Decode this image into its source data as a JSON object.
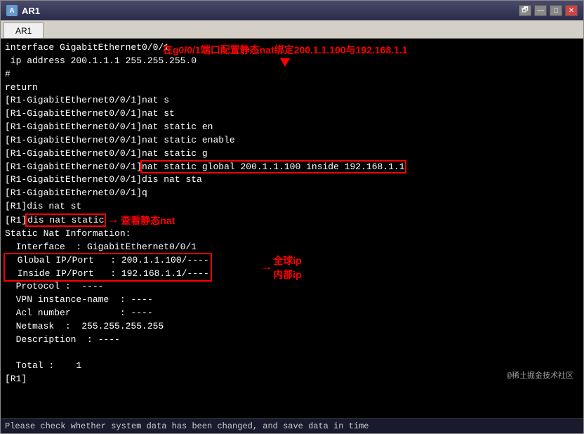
{
  "window": {
    "title": "AR1",
    "tab": "AR1"
  },
  "terminal": {
    "lines": [
      "interface GigabitEthernet0/0/1",
      " ip address 200.1.1.1 255.255.255.0",
      "#",
      "return",
      "[R1-GigabitEthernet0/0/1]nat s",
      "[R1-GigabitEthernet0/0/1]nat st",
      "[R1-GigabitEthernet0/0/1]nat static en",
      "[R1-GigabitEthernet0/0/1]nat static enable",
      "[R1-GigabitEthernet0/0/1]nat static g",
      "[R1-GigabitEthernet0/0/1]nat static global 200.1.1.100 inside 192.168.1.1",
      "[R1-GigabitEthernet0/0/1]dis nat sta",
      "[R1-GigabitEthernet0/0/1]q",
      "[R1]dis nat st",
      "[R1]dis nat static",
      "Static Nat Information:",
      "  Interface  : GigabitEthernet0/0/1",
      "  Global IP/Port   : 200.1.1.100/----",
      "  Inside IP/Port   : 192.168.1.1/----",
      "  Protocol :  ----",
      "  VPN instance-name  : ----",
      "  Acl number         : ----",
      "  Netmask  :  255.255.255.255",
      "  Description  : ----",
      "",
      "  Total :    1",
      "[R1]"
    ],
    "annotation_top": "在g0/0/1端口配置静态nat绑定200.1.1.100与192.168.1.1",
    "annotation_nat_static": "查看静态nat",
    "annotation_global": "全球ip",
    "annotation_inside": "内部ip",
    "bottom_text": "Please check whether system data has been changed, and save data in time",
    "watermark": "@稀土掘金技术社区"
  },
  "titlebar": {
    "restore_label": "🗗",
    "minimize_label": "—",
    "maximize_label": "□",
    "close_label": "✕"
  }
}
